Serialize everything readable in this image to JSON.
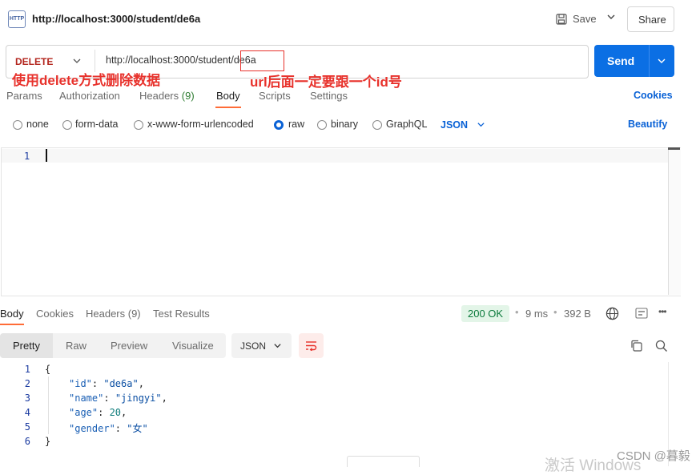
{
  "header": {
    "method_badge": "HTTP",
    "title": "http://localhost:3000/student/de6a",
    "save_label": "Save",
    "share_label": "Share"
  },
  "request": {
    "method": "DELETE",
    "url": "http://localhost:3000/student/de6a",
    "url_prefix": "http://localhost:3000/student/",
    "url_id": "de6a",
    "send_label": "Send"
  },
  "annotations": {
    "left": "使用delete方式删除数据",
    "right": "url后面一定要跟一个id号"
  },
  "request_tabs": {
    "params": "Params",
    "authorization": "Authorization",
    "headers": "Headers",
    "headers_count": "(9)",
    "body": "Body",
    "scripts": "Scripts",
    "settings": "Settings",
    "cookies": "Cookies"
  },
  "body_options": {
    "none": "none",
    "form_data": "form-data",
    "urlencoded": "x-www-form-urlencoded",
    "raw": "raw",
    "binary": "binary",
    "graphql": "GraphQL",
    "format": "JSON",
    "beautify": "Beautify",
    "selected": "raw"
  },
  "editor": {
    "line_numbers": [
      "1"
    ]
  },
  "response_tabs": {
    "body": "Body",
    "cookies": "Cookies",
    "headers": "Headers (9)",
    "test_results": "Test Results",
    "status": "200 OK",
    "time": "9 ms",
    "size": "392 B"
  },
  "response_view": {
    "pretty": "Pretty",
    "raw": "Raw",
    "preview": "Preview",
    "visualize": "Visualize",
    "format": "JSON"
  },
  "response_body": {
    "line_numbers": [
      "1",
      "2",
      "3",
      "4",
      "5",
      "6"
    ],
    "open_brace": "{",
    "close_brace": "}",
    "lines": [
      {
        "key": "\"id\"",
        "value": "\"de6a\"",
        "suffix": ","
      },
      {
        "key": "\"name\"",
        "value": "\"jingyi\"",
        "suffix": ","
      },
      {
        "key": "\"age\"",
        "value": "20",
        "suffix": ","
      },
      {
        "key": "\"gender\"",
        "value": "\"女\"",
        "suffix": ""
      }
    ]
  },
  "watermark": {
    "csdn": "CSDN @暮毅",
    "activate": "激活 Windows"
  },
  "colors": {
    "accent_blue": "#0a62d6",
    "send_blue": "#0b6fe4",
    "annotation_red": "#e8322c",
    "method_red": "#b3261e",
    "status_green_bg": "#e3f5e8",
    "status_green_text": "#0b7a3b"
  }
}
